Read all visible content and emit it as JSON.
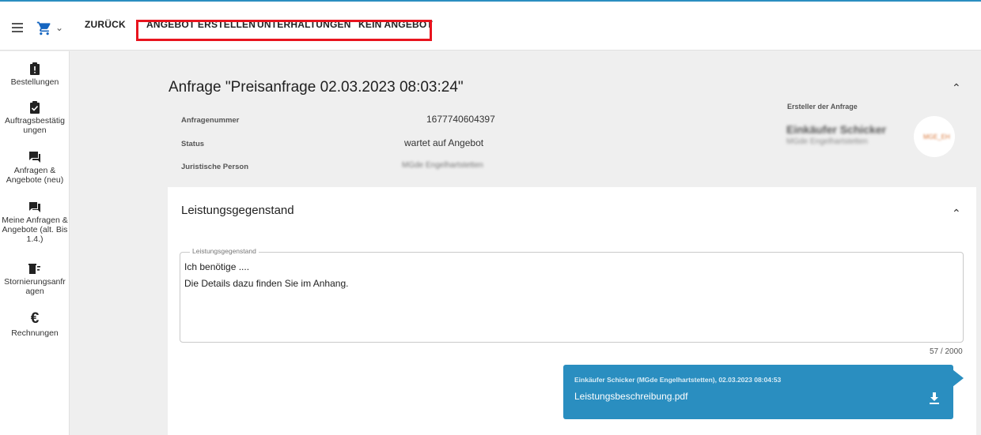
{
  "toolbar": {
    "back_label": "ZURÜCK",
    "create_offer_label": "ANGEBOT ERSTELLEN",
    "conversations_label": "UNTERHALTUNGEN",
    "no_offer_label": "KEIN ANGEBOT"
  },
  "sidebar": {
    "items": [
      {
        "label": "Bestellungen",
        "icon": "clipboard-alert-icon"
      },
      {
        "label": "Auftragsbestätig ungen",
        "icon": "clipboard-check-icon"
      },
      {
        "label": "Anfragen & Angebote (neu)",
        "icon": "chat-bubbles-icon"
      },
      {
        "label": "Meine Anfragen & Angebote (alt. Bis 1.4.)",
        "icon": "forum-icon"
      },
      {
        "label": "Stornierungsanfr agen",
        "icon": "delete-sweep-icon"
      },
      {
        "label": "Rechnungen",
        "icon": "euro-icon"
      }
    ]
  },
  "request": {
    "title": "Anfrage \"Preisanfrage 02.03.2023 08:03:24\"",
    "number_label": "Anfragenummer",
    "number_value": "1677740604397",
    "status_label": "Status",
    "status_value": "wartet auf Angebot",
    "legal_label": "Juristische Person",
    "legal_value": "MGde Engelhartstetten",
    "creator_label": "Ersteller der Anfrage",
    "creator_name": "Einkäufer Schicker",
    "creator_org": "MGde Engelhartstetten",
    "avatar_text": "MGE_EH"
  },
  "service": {
    "title": "Leistungsgegenstand",
    "field_label": "Leistungsgegenstand",
    "line1": "Ich benötige ....",
    "line2": "Die Details dazu finden Sie im Anhang.",
    "counter": "57 / 2000"
  },
  "attachment": {
    "meta": "Einkäufer Schicker (MGde Engelhartstetten), 02.03.2023 08:04:53",
    "filename": "Leistungsbeschreibung.pdf"
  },
  "colors": {
    "accent": "#2a8ec0",
    "highlight": "#e8141e"
  }
}
